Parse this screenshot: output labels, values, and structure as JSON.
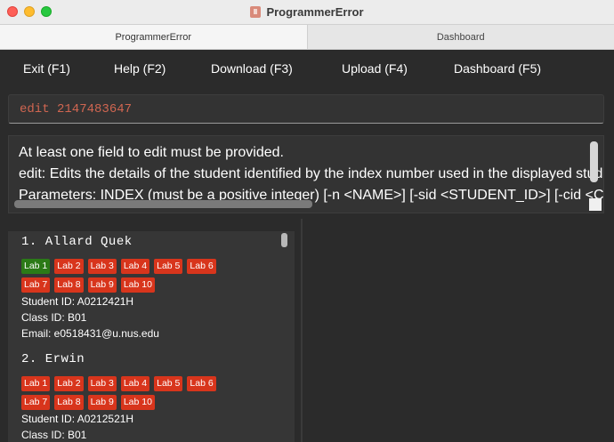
{
  "window": {
    "title": "ProgrammerError"
  },
  "tabs": [
    {
      "label": "ProgrammerError"
    },
    {
      "label": "Dashboard"
    }
  ],
  "menu": {
    "exit": "Exit (F1)",
    "help": "Help (F2)",
    "download": "Download (F3)",
    "upload": "Upload (F4)",
    "dashboard": "Dashboard (F5)"
  },
  "command": {
    "value": "edit 2147483647"
  },
  "result": {
    "lines": [
      "At least one field to edit must be provided.",
      "edit: Edits the details of the student identified by the index number used in the displayed student list.",
      "Parameters: INDEX (must be a positive integer) [-n <NAME>] [-sid <STUDENT_ID>] [-cid <CLASS_ID>]"
    ]
  },
  "students": [
    {
      "name": "1.  Allard Quek",
      "labs": [
        {
          "label": "Lab 1",
          "done": true
        },
        {
          "label": "Lab 2",
          "done": false
        },
        {
          "label": "Lab 3",
          "done": false
        },
        {
          "label": "Lab 4",
          "done": false
        },
        {
          "label": "Lab 5",
          "done": false
        },
        {
          "label": "Lab 6",
          "done": false
        },
        {
          "label": "Lab 7",
          "done": false
        },
        {
          "label": "Lab 8",
          "done": false
        },
        {
          "label": "Lab 9",
          "done": false
        },
        {
          "label": "Lab 10",
          "done": false
        }
      ],
      "student_id": "Student ID: A0212421H",
      "class_id": "Class ID: B01",
      "email": "Email: e0518431@u.nus.edu"
    },
    {
      "name": "2.  Erwin",
      "labs": [
        {
          "label": "Lab 1",
          "done": false
        },
        {
          "label": "Lab 2",
          "done": false
        },
        {
          "label": "Lab 3",
          "done": false
        },
        {
          "label": "Lab 4",
          "done": false
        },
        {
          "label": "Lab 5",
          "done": false
        },
        {
          "label": "Lab 6",
          "done": false
        },
        {
          "label": "Lab 7",
          "done": false
        },
        {
          "label": "Lab 8",
          "done": false
        },
        {
          "label": "Lab 9",
          "done": false
        },
        {
          "label": "Lab 10",
          "done": false
        }
      ],
      "student_id": "Student ID: A0212521H",
      "class_id": "Class ID: B01"
    }
  ],
  "colors": {
    "lab_pending": "#d8351c",
    "lab_done": "#2b7a17",
    "command_text": "#d06651"
  }
}
